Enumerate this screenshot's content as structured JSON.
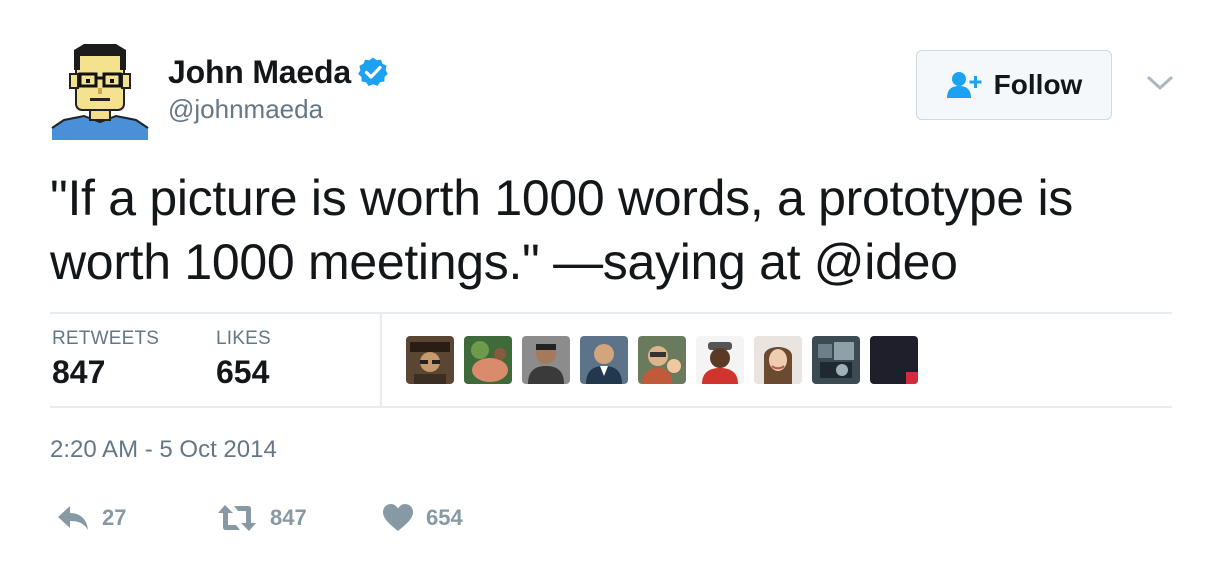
{
  "author": {
    "display_name": "John Maeda",
    "handle": "@johnmaeda",
    "verified": true,
    "avatar_icon": "pixel-art-avatar"
  },
  "header": {
    "follow_label": "Follow",
    "follow_icon": "add-user-icon",
    "menu_icon": "chevron-down-icon"
  },
  "tweet": {
    "text_line1": "\"If a picture is worth 1000 words, a prototype is",
    "text_line2": "worth 1000 meetings.\" —saying at @ideo",
    "timestamp": "2:20 AM - 5 Oct 2014"
  },
  "stats": {
    "retweets_label": "RETWEETS",
    "retweets_count": "847",
    "likes_label": "LIKES",
    "likes_count": "654"
  },
  "likers": [
    {
      "name": "liker-1"
    },
    {
      "name": "liker-2"
    },
    {
      "name": "liker-3"
    },
    {
      "name": "liker-4"
    },
    {
      "name": "liker-5"
    },
    {
      "name": "liker-6"
    },
    {
      "name": "liker-7"
    },
    {
      "name": "liker-8"
    },
    {
      "name": "liker-9"
    }
  ],
  "actions": {
    "reply_count": "27",
    "retweet_count": "847",
    "like_count": "654"
  },
  "colors": {
    "accent": "#1da1f2",
    "secondary_text": "#657786",
    "action_gray": "#8899a6",
    "divider": "#e6ecf0"
  }
}
